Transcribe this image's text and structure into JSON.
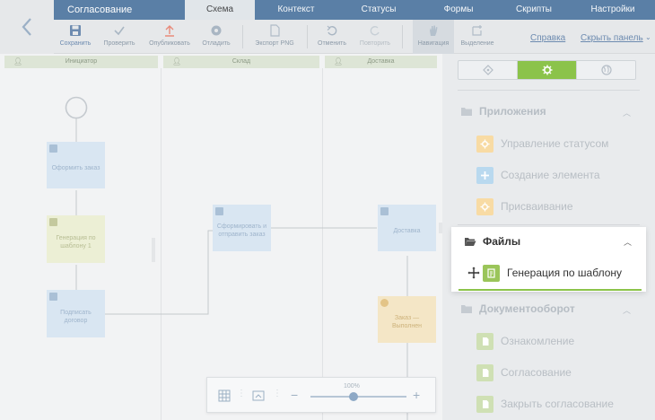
{
  "header": {
    "title": "Согласование",
    "tabs": [
      {
        "label": "Схема",
        "active": true
      },
      {
        "label": "Контекст"
      },
      {
        "label": "Статусы"
      },
      {
        "label": "Формы"
      },
      {
        "label": "Скрипты"
      },
      {
        "label": "Настройки"
      }
    ]
  },
  "toolbar": {
    "save": "Сохранить",
    "check": "Проверить",
    "publish": "Опубликовать",
    "discard": "Отладить",
    "export": "Экспорт PNG",
    "undo": "Отменить",
    "redo": "Повторить",
    "navigation": "Навигация",
    "selection": "Выделение",
    "help_link": "Справка",
    "hide_panel_link": "Скрыть панель"
  },
  "lanes": [
    {
      "label": "Инициатор"
    },
    {
      "label": "Склад"
    },
    {
      "label": "Доставка"
    }
  ],
  "nodes": {
    "order": "Оформить заказ",
    "template_gen": "Генерация по шаблону 1",
    "sign": "Подписать договор",
    "form_send": "Сформировать и отправить заказ",
    "delivery": "Доставка",
    "order_done": "Заказ — Выполнен"
  },
  "zoom": {
    "level": "100%",
    "value_percent": 100
  },
  "panel": {
    "groups": {
      "apps": "Приложения",
      "files": "Файлы",
      "docflow": "Документооборот"
    },
    "items": {
      "status_mgmt": "Управление статусом",
      "create_element": "Создание элемента",
      "assign": "Присваивание",
      "template_gen": "Генерация по шаблону",
      "familiarize": "Ознакомление",
      "approval": "Согласование",
      "close_approval": "Закрыть согласование"
    }
  },
  "colors": {
    "accent_green": "#8bc34a",
    "tab_bar_blue": "#5a7fa6",
    "item_orange": "#f4b64a",
    "item_blue": "#6fb0e0"
  }
}
